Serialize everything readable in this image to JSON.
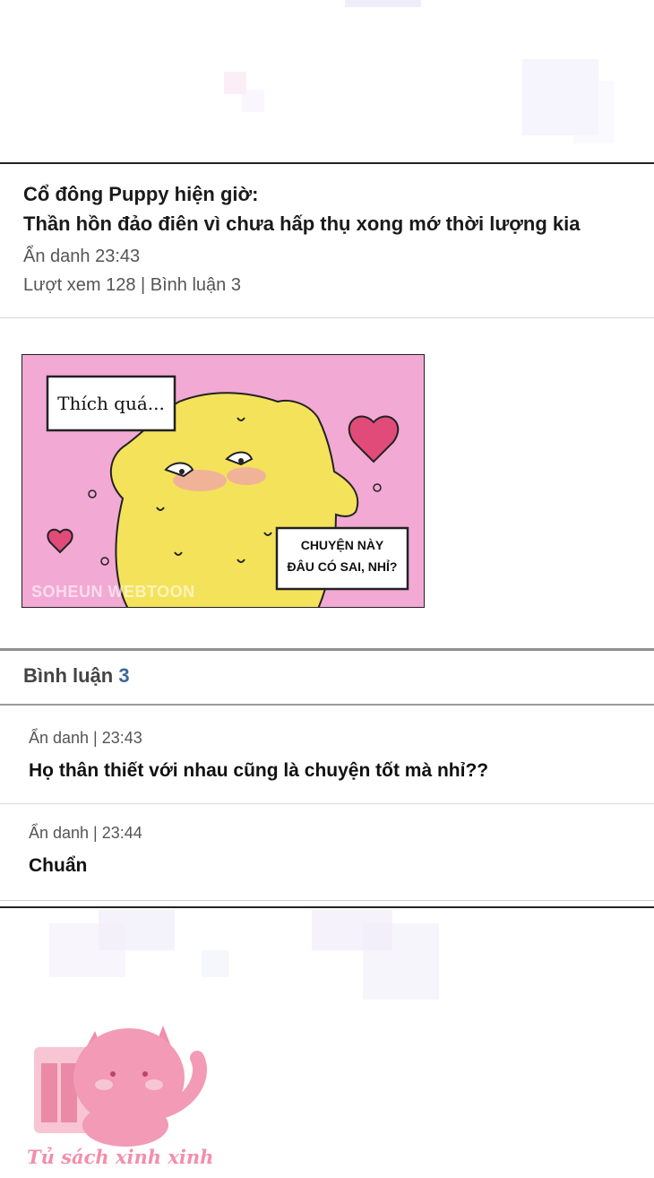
{
  "post": {
    "title_line1": "Cổ đông Puppy hiện giờ:",
    "title_line2": "Thần hồn đảo điên vì chưa hấp thụ xong mớ thời lượng kia",
    "author_time": "Ẩn danh 23:43",
    "stats": "Lượt xem 128 | Bình luận 3"
  },
  "panel": {
    "bubble_left": "Thích quá...",
    "bubble_right_line1": "CHUYỆN NÀY",
    "bubble_right_line2": "ĐÂU CÓ SAI, NHỈ?",
    "watermark": "SOHEUN WEBTOON",
    "bg_color": "#f2a9d4",
    "creature_color": "#f4e25a"
  },
  "comments": {
    "label": "Bình luận",
    "count": "3",
    "items": [
      {
        "meta": "Ẩn danh | 23:43",
        "text": "Họ thân thiết với nhau cũng là chuyện tốt mà nhỉ??"
      },
      {
        "meta": "Ẩn danh | 23:44",
        "text": "Chuẩn"
      }
    ]
  },
  "footer": {
    "watermark_text": "Tủ sách xinh xinh",
    "watermark_icon": "pink-cat-icon"
  }
}
